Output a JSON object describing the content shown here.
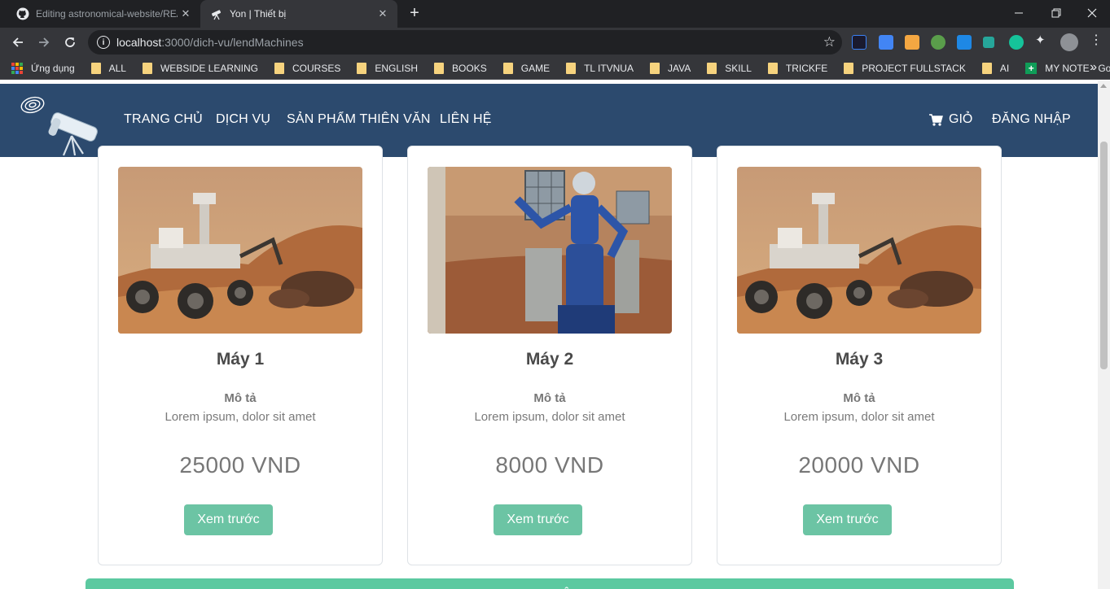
{
  "browser": {
    "tabs": [
      {
        "title": "Editing astronomical-website/REA",
        "active": false,
        "icon": "github-icon"
      },
      {
        "title": "Yon | Thiết bị",
        "active": true,
        "icon": "telescope-icon"
      }
    ],
    "url_host": "localhost",
    "url_path": ":3000/dich-vu/lendMachines",
    "bookmarks": [
      {
        "label": "Ứng dụng",
        "icon": "apps-icon"
      },
      {
        "label": "ALL",
        "icon": "folder-icon"
      },
      {
        "label": "WEBSIDE LEARNING",
        "icon": "folder-icon"
      },
      {
        "label": "COURSES",
        "icon": "folder-icon"
      },
      {
        "label": "ENGLISH",
        "icon": "folder-icon"
      },
      {
        "label": "BOOKS",
        "icon": "folder-icon"
      },
      {
        "label": "GAME",
        "icon": "folder-icon"
      },
      {
        "label": "TL ITVNUA",
        "icon": "folder-icon"
      },
      {
        "label": "JAVA",
        "icon": "folder-icon"
      },
      {
        "label": "SKILL",
        "icon": "folder-icon"
      },
      {
        "label": "TRICKFE",
        "icon": "folder-icon"
      },
      {
        "label": "PROJECT FULLSTACK",
        "icon": "folder-icon"
      },
      {
        "label": "AI",
        "icon": "folder-icon"
      },
      {
        "label": "MY NOTE - Google...",
        "icon": "google-sheets-icon"
      }
    ]
  },
  "site": {
    "nav": [
      {
        "label": "TRANG CHỦ"
      },
      {
        "label": "DỊCH VỤ"
      },
      {
        "label": "SẢN PHẨM THIÊN VĂN"
      },
      {
        "label": "LIÊN HỆ"
      }
    ],
    "cart_label": "GIỎ",
    "login_label": "ĐĂNG NHẬP"
  },
  "products": [
    {
      "name": "Máy 1",
      "desc_label": "Mô tả",
      "desc": "Lorem ipsum, dolor sit amet",
      "price": "25000 VND",
      "button": "Xem trước",
      "image": "mars-rover"
    },
    {
      "name": "Máy 2",
      "desc_label": "Mô tả",
      "desc": "Lorem ipsum, dolor sit amet",
      "price": "8000 VND",
      "button": "Xem trước",
      "image": "humanoid-robot"
    },
    {
      "name": "Máy 3",
      "desc_label": "Mô tả",
      "desc": "Lorem ipsum, dolor sit amet",
      "price": "20000 VND",
      "button": "Xem trước",
      "image": "mars-rover"
    }
  ],
  "bottom_button": "XEM THÊM",
  "colors": {
    "header_bg": "#2c4a6e",
    "button": "#6cc4a4",
    "bottom_bar": "#5cc9a0"
  }
}
